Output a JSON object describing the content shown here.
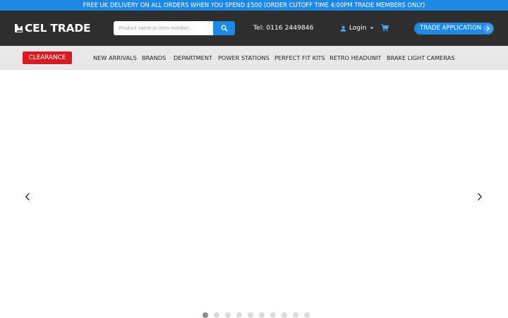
{
  "promo": {
    "text": "FREE UK DELIVERY ON ALL ORDERS WHEN YOU SPEND £500 (ORDER CUTOFF TIME 4:00PM TRADE MEMBERS ONLY)"
  },
  "header": {
    "logo_text": "CEL TRADE",
    "search": {
      "placeholder": "Product name or item number...",
      "value": "",
      "button_icon": "search-icon"
    },
    "phone": "Tel: 0116 2449846",
    "login_label": "Login",
    "login_icons": [
      "user-icon",
      "caret-down-icon"
    ],
    "cart_icon": "cart-icon",
    "trade_button_label": "TRADE APPLICATION",
    "trade_button_icon": "chevron-right-icon"
  },
  "nav": {
    "clearance_label": "CLEARANCE",
    "items": [
      {
        "label": "NEW ARRIVALS"
      },
      {
        "label": "BRANDS"
      },
      {
        "label": "DEPARTMENT"
      },
      {
        "label": "POWER STATIONS"
      },
      {
        "label": "PERFECT FIT KITS"
      },
      {
        "label": "RETRO HEADUNIT"
      },
      {
        "label": "BRAKE LIGHT CAMERAS"
      }
    ]
  },
  "hero": {
    "prev_icon": "chevron-left-icon",
    "next_icon": "chevron-right-icon",
    "slide_count": 10,
    "active_slide": 1
  },
  "colors": {
    "accent": "#1e88e5",
    "header_bg": "#2e2e2e",
    "nav_bg": "#e8e8e8",
    "clearance": "#d71920"
  }
}
